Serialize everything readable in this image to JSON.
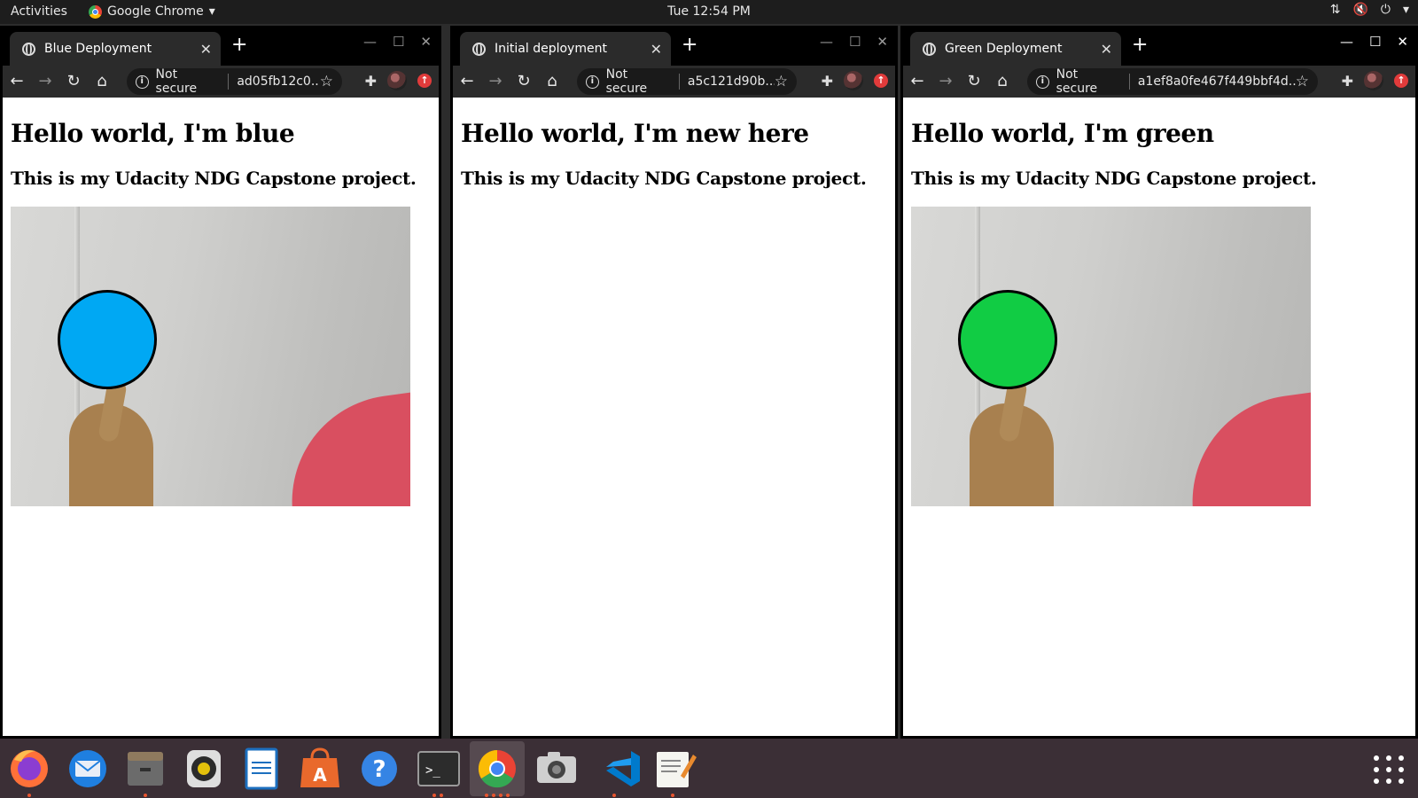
{
  "topbar": {
    "activities": "Activities",
    "app_name": "Google Chrome",
    "clock": "Tue 12:54 PM"
  },
  "windows": [
    {
      "tab_title": "Blue Deployment",
      "not_secure": "Not secure",
      "url": "ad05fb12c0...",
      "heading": "Hello world, I'm blue",
      "subheading": "This is my Udacity NDG Capstone project.",
      "has_image": true,
      "circle_color": "#00a8f3"
    },
    {
      "tab_title": "Initial deployment",
      "not_secure": "Not secure",
      "url": "a5c121d90b...",
      "heading": "Hello world, I'm new here",
      "subheading": "This is my Udacity NDG Capstone project.",
      "has_image": false
    },
    {
      "tab_title": "Green Deployment",
      "not_secure": "Not secure",
      "url": "a1ef8a0fe467f449bbf4d...",
      "heading": "Hello world, I'm green",
      "subheading": "This is my Udacity NDG Capstone project.",
      "has_image": true,
      "circle_color": "#11cc44"
    }
  ],
  "dock": {
    "apps": [
      "firefox-icon",
      "thunderbird-icon",
      "files-icon",
      "rhythmbox-icon",
      "libreoffice-writer-icon",
      "software-center-icon",
      "help-icon",
      "terminal-icon",
      "chrome-icon",
      "screenshot-icon",
      "vscode-icon",
      "text-editor-icon"
    ],
    "show_apps_icon": "grid-icon"
  }
}
